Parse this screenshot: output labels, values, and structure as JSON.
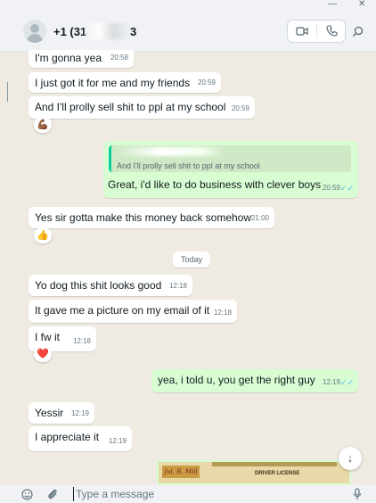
{
  "window": {
    "minimize_glyph": "—",
    "close_glyph": "✕"
  },
  "header": {
    "contact_name": "+1 (314",
    "contact_suffix": "3",
    "video_icon": "video-camera-icon",
    "call_icon": "phone-icon",
    "search_icon": "search-icon"
  },
  "messages": [
    {
      "dir": "in",
      "text": "I'm gonna  yea",
      "time": "20:58"
    },
    {
      "dir": "in",
      "text": "I just got it for me and my friends",
      "time": "20:59"
    },
    {
      "dir": "in",
      "text": "And I'll prolly sell shit to ppl at my school",
      "time": "20:59",
      "reaction": "💪🏾"
    },
    {
      "dir": "out",
      "quote": "And I'll prolly sell shit to ppl at my school",
      "text": "Great, i'd like to do business with clever boys",
      "time": "20:59",
      "ticks": "✓✓"
    },
    {
      "dir": "in",
      "text": "Yes sir gotta make this money back somehow",
      "time": "21:00",
      "reaction": "👍"
    },
    {
      "dir": "in",
      "text": "Yo dog this shit looks good",
      "time": "12:18"
    },
    {
      "dir": "in",
      "text": "It gave me a picture on my email of it",
      "time": "12:18"
    },
    {
      "dir": "in",
      "text": "I fw it",
      "time": "12:18",
      "reaction": "❤️"
    },
    {
      "dir": "out",
      "text": "yea, i told u, you get the right guy",
      "time": "12:19",
      "ticks": "✓✓"
    },
    {
      "dir": "in",
      "text": "Yessir",
      "time": "12:19"
    },
    {
      "dir": "in",
      "text": "I appreciate it",
      "time": "12:19"
    }
  ],
  "date_separator": "Today",
  "image_attachment": {
    "stamp_text": "Jul. R. Mill",
    "license_text": "DRIVER LICENSE"
  },
  "scroll_down_glyph": "↓",
  "composer": {
    "placeholder": "Type a message",
    "emoji_glyph": "☺",
    "attach_glyph": "🖉",
    "mic_glyph": "🎙"
  },
  "colors": {
    "incoming": "#ffffff",
    "outgoing": "#d9fdd3",
    "background": "#efeae2",
    "read_ticks": "#53bdeb",
    "accent": "#06cf9c"
  }
}
